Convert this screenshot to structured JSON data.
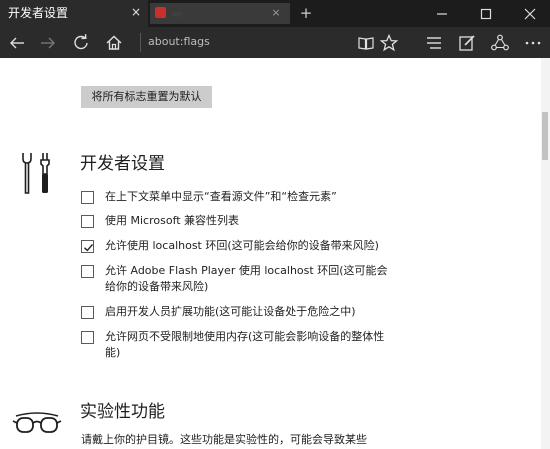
{
  "tabs": {
    "active": {
      "title": "开发者设置",
      "close": "×"
    },
    "inactive": {
      "title": "...",
      "close": "×"
    },
    "new_tab": "+"
  },
  "address_bar": {
    "url": "about:flags"
  },
  "flags": {
    "reset_label": "将所有标志重置为默认",
    "developer": {
      "title": "开发者设置",
      "options": [
        {
          "label": "在上下文菜单中显示“查看源文件”和“检查元素”",
          "checked": false
        },
        {
          "label": "使用 Microsoft 兼容性列表",
          "checked": false
        },
        {
          "label": "允许使用 localhost 环回(这可能会给你的设备带来风险)",
          "checked": true
        },
        {
          "label": "允许 Adobe Flash Player 使用 localhost 环回(这可能会给你的设备带来风险)",
          "checked": false
        },
        {
          "label": "启用开发人员扩展功能(这可能让设备处于危险之中)",
          "checked": false
        },
        {
          "label": "允许网页不受限制地使用内存(这可能会影响设备的整体性能)",
          "checked": false
        }
      ]
    },
    "experimental": {
      "title": "实验性功能",
      "description": "请戴上你的护目镜。这些功能是实验性的，可能会导致某些"
    }
  },
  "colors": {
    "tabbar": "#1c1c1c",
    "toolbar": "#2b2b2b",
    "button": "#cccccc",
    "page": "#ffffff"
  }
}
